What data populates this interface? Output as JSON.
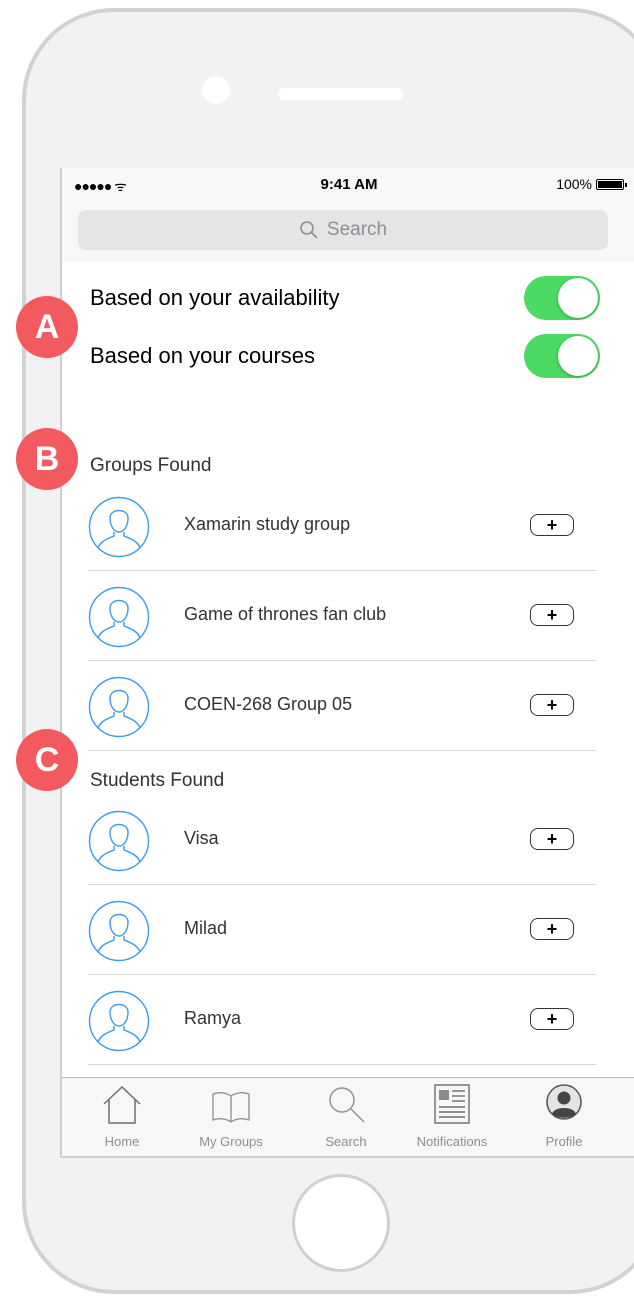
{
  "status": {
    "signal": "●●●●● ",
    "time": "9:41 AM",
    "battery": "100%"
  },
  "search": {
    "placeholder": "Search"
  },
  "filters": [
    {
      "label": "Based on your availability",
      "enabled": true
    },
    {
      "label": "Based on your courses",
      "enabled": true
    }
  ],
  "groups": {
    "title": "Groups Found",
    "items": [
      {
        "name": "Xamarin study group"
      },
      {
        "name": "Game of thrones fan club"
      },
      {
        "name": "COEN-268 Group 05"
      }
    ]
  },
  "students": {
    "title": "Students Found",
    "items": [
      {
        "name": "Visa"
      },
      {
        "name": "Milad"
      },
      {
        "name": "Ramya"
      }
    ]
  },
  "tabs": [
    {
      "label": "Home",
      "icon": "home-icon"
    },
    {
      "label": "My Groups",
      "icon": "book-icon"
    },
    {
      "label": "Search",
      "icon": "search-icon"
    },
    {
      "label": "Notifications",
      "icon": "notifications-icon"
    },
    {
      "label": "Profile",
      "icon": "profile-icon"
    }
  ],
  "markers": {
    "a": "A",
    "b": "B",
    "c": "C"
  },
  "colors": {
    "toggle_on": "#4cd964",
    "avatar_stroke": "#3b9be8",
    "marker": "#f25a5f"
  }
}
